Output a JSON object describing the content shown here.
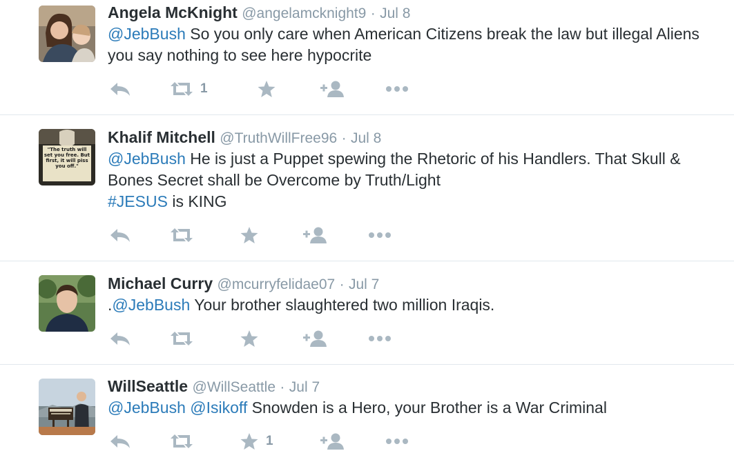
{
  "colors": {
    "link": "#2b7bb9",
    "icon": "#aab8c2",
    "meta": "#8899a6",
    "text": "#292f33"
  },
  "icons": [
    "reply-icon",
    "retweet-icon",
    "favorite-icon",
    "follow-icon",
    "more-icon"
  ],
  "tweets": [
    {
      "name": "Angela McKnight",
      "handle": "@angelamcknight9",
      "sep": "·",
      "time": "Jul 8",
      "mention1": "@JebBush",
      "body": " So you only care when American Citizens break the law but illegal Aliens you say nothing to see here hypocrite",
      "retweets": "1",
      "favorites": ""
    },
    {
      "name": "Khalif Mitchell",
      "handle": "@TruthWillFree96",
      "sep": "·",
      "time": "Jul 8",
      "mention1": "@JebBush",
      "body": " He is just a Puppet spewing the Rhetoric of his Handlers. That Skull & Bones Secret shall be Overcome by Truth/Light",
      "hashtag": "#JESUS",
      "body2": " is KING",
      "avatar_text": "\"The truth will set you free. But first, it will piss you off.\"",
      "retweets": "",
      "favorites": ""
    },
    {
      "name": "Michael Curry",
      "handle": "@mcurryfelidae07",
      "sep": "·",
      "time": "Jul 7",
      "prefix": ".",
      "mention1": "@JebBush",
      "body": " Your brother slaughtered two million Iraqis.",
      "retweets": "",
      "favorites": ""
    },
    {
      "name": "WillSeattle",
      "handle": "@WillSeattle",
      "sep": "·",
      "time": "Jul 7",
      "mention1": "@JebBush",
      "mention2": "@Isikoff",
      "body": " Snowden is a Hero, your Brother is a War Criminal",
      "retweets": "",
      "favorites": "1"
    }
  ]
}
